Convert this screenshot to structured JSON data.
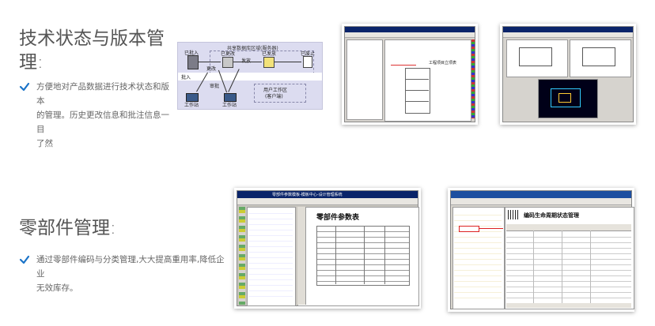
{
  "section1": {
    "title_line1": "技术状态与版本管",
    "title_line2": "理:",
    "bullet_line1": "方便地对产品数据进行技术状态和版本",
    "bullet_line2": "的管理。历史更改信息和批注信息一目",
    "bullet_line3": "了然"
  },
  "section2": {
    "title": "零部件管理:",
    "bullet_line1": "通过零部件编码与分类管理,大大提高重用率,降低企业",
    "bullet_line2": "无效库存。"
  },
  "diagram": {
    "header": "共享数据库区域(服务器)",
    "node1": "已批入",
    "node2": "已更改",
    "node3": "已发放",
    "node4": "已废止",
    "arrow_release": "发放",
    "arrow_change": "更改",
    "arrow_approve": "审批",
    "left_label": "批入",
    "user_area_line1": "用户工作区",
    "user_area_line2": "(客户端)",
    "ws1": "工作站",
    "ws2": "工作站"
  },
  "screens": {
    "ss2_caption": "工程项目立项表",
    "ss4_title": "零部件参数表",
    "ss4_window_title": "零部件参数模板-模板中心-设计管理系统",
    "ss5_title": "编码生命周期状态管理"
  },
  "colors": {
    "check": "#1a73c8",
    "title_text": "#555555",
    "body_text": "#666666"
  }
}
